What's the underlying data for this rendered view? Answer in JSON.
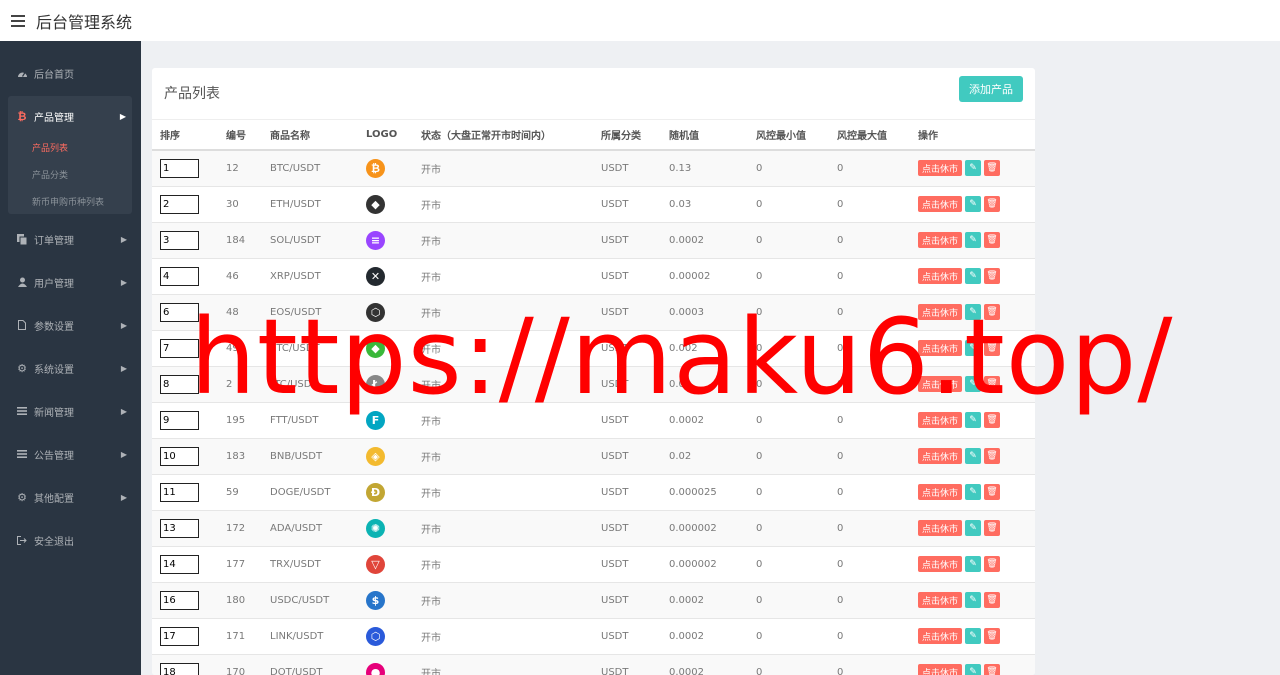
{
  "header": {
    "title": "后台管理系统"
  },
  "sidebar": {
    "items": [
      {
        "label": "后台首页",
        "icon": "dashboard-icon"
      },
      {
        "label": "产品管理",
        "icon": "bitcoin-icon"
      },
      {
        "label": "订单管理",
        "icon": "copy-icon"
      },
      {
        "label": "用户管理",
        "icon": "user-icon"
      },
      {
        "label": "参数设置",
        "icon": "file-icon"
      },
      {
        "label": "系统设置",
        "icon": "cogs-icon"
      },
      {
        "label": "新闻管理",
        "icon": "list-icon"
      },
      {
        "label": "公告管理",
        "icon": "list-icon"
      },
      {
        "label": "其他配置",
        "icon": "gear-icon"
      },
      {
        "label": "安全退出",
        "icon": "signout-icon"
      }
    ],
    "sub_items": [
      "产品列表",
      "产品分类",
      "新币申购币种列表"
    ]
  },
  "panel": {
    "title": "产品列表",
    "add_label": "添加产品"
  },
  "table": {
    "headers": [
      "排序",
      "编号",
      "商品名称",
      "LOGO",
      "状态（大盘正常开市时间内）",
      "所属分类",
      "随机值",
      "风控最小值",
      "风控最大值",
      "操作"
    ],
    "op_close_label": "点击休市",
    "rows": [
      {
        "sort": "1",
        "id": "12",
        "name": "BTC/USDT",
        "status": "开市",
        "category": "USDT",
        "random": "0.13",
        "min": "0",
        "max": "0",
        "logo": "btc",
        "logo_color": "#f7931a"
      },
      {
        "sort": "2",
        "id": "30",
        "name": "ETH/USDT",
        "status": "开市",
        "category": "USDT",
        "random": "0.03",
        "min": "0",
        "max": "0",
        "logo": "eth",
        "logo_color": "#333333"
      },
      {
        "sort": "3",
        "id": "184",
        "name": "SOL/USDT",
        "status": "开市",
        "category": "USDT",
        "random": "0.0002",
        "min": "0",
        "max": "0",
        "logo": "sol",
        "logo_color": "#9945ff"
      },
      {
        "sort": "4",
        "id": "46",
        "name": "XRP/USDT",
        "status": "开市",
        "category": "USDT",
        "random": "0.00002",
        "min": "0",
        "max": "0",
        "logo": "xrp",
        "logo_color": "#23292f"
      },
      {
        "sort": "6",
        "id": "48",
        "name": "EOS/USDT",
        "status": "开市",
        "category": "USDT",
        "random": "0.0003",
        "min": "0",
        "max": "0",
        "logo": "eos",
        "logo_color": "#333333"
      },
      {
        "sort": "7",
        "id": "49",
        "name": "ETC/USDT",
        "status": "开市",
        "category": "USDT",
        "random": "0.002",
        "min": "0",
        "max": "0",
        "logo": "etc",
        "logo_color": "#3ab83a"
      },
      {
        "sort": "8",
        "id": "2",
        "name": "LTC/USDT",
        "status": "开市",
        "category": "USDT",
        "random": "0.03",
        "min": "0",
        "max": "0",
        "logo": "ltc",
        "logo_color": "#888888"
      },
      {
        "sort": "9",
        "id": "195",
        "name": "FTT/USDT",
        "status": "开市",
        "category": "USDT",
        "random": "0.0002",
        "min": "0",
        "max": "0",
        "logo": "ftt",
        "logo_color": "#02a6c2"
      },
      {
        "sort": "10",
        "id": "183",
        "name": "BNB/USDT",
        "status": "开市",
        "category": "USDT",
        "random": "0.02",
        "min": "0",
        "max": "0",
        "logo": "bnb",
        "logo_color": "#f3ba2f"
      },
      {
        "sort": "11",
        "id": "59",
        "name": "DOGE/USDT",
        "status": "开市",
        "category": "USDT",
        "random": "0.000025",
        "min": "0",
        "max": "0",
        "logo": "doge",
        "logo_color": "#c2a633"
      },
      {
        "sort": "13",
        "id": "172",
        "name": "ADA/USDT",
        "status": "开市",
        "category": "USDT",
        "random": "0.000002",
        "min": "0",
        "max": "0",
        "logo": "ada",
        "logo_color": "#0bb3b3"
      },
      {
        "sort": "14",
        "id": "177",
        "name": "TRX/USDT",
        "status": "开市",
        "category": "USDT",
        "random": "0.000002",
        "min": "0",
        "max": "0",
        "logo": "trx",
        "logo_color": "#e0453a"
      },
      {
        "sort": "16",
        "id": "180",
        "name": "USDC/USDT",
        "status": "开市",
        "category": "USDT",
        "random": "0.0002",
        "min": "0",
        "max": "0",
        "logo": "usdc",
        "logo_color": "#2775ca"
      },
      {
        "sort": "17",
        "id": "171",
        "name": "LINK/USDT",
        "status": "开市",
        "category": "USDT",
        "random": "0.0002",
        "min": "0",
        "max": "0",
        "logo": "link",
        "logo_color": "#2a5ada"
      },
      {
        "sort": "18",
        "id": "170",
        "name": "DOT/USDT",
        "status": "开市",
        "category": "USDT",
        "random": "0.0002",
        "min": "0",
        "max": "0",
        "logo": "dot",
        "logo_color": "#e6007a"
      }
    ]
  },
  "watermark": {
    "text": "https://maku6.top/"
  }
}
